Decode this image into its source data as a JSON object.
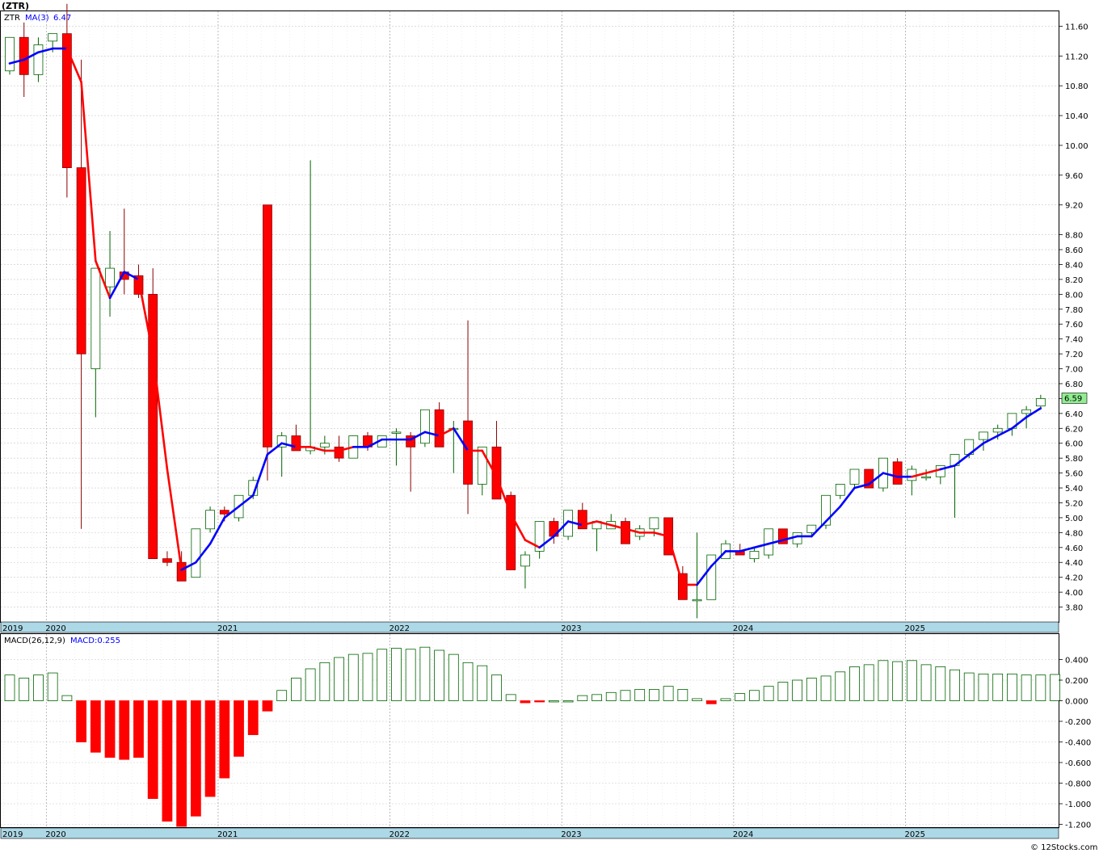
{
  "header": {
    "symbol_label": "(ZTR)",
    "legend_symbol": "ZTR",
    "legend_ma": "MA(3)",
    "legend_ma_value": "6.47",
    "last_price": "6.59"
  },
  "macd_header": {
    "label": "MACD(26,12,9)",
    "value_label": "MACD:0.255"
  },
  "footer": {
    "copyright": "© 12Stocks.com"
  },
  "colors": {
    "up": "#006400",
    "down": "#ff0000",
    "ma_up": "#0000ff",
    "ma_down": "#ff0000",
    "axis_band": "#add8e6",
    "last_price_bg": "#90ee90"
  },
  "chart_data": [
    {
      "type": "candlestick",
      "name": "price",
      "ylim": [
        3.6,
        11.8
      ],
      "ticks": [
        3.8,
        4.0,
        4.2,
        4.4,
        4.6,
        4.8,
        5.0,
        5.2,
        5.4,
        5.6,
        5.8,
        6.0,
        6.2,
        6.4,
        6.6,
        6.8,
        7.0,
        7.2,
        7.4,
        7.6,
        7.8,
        8.0,
        8.2,
        8.4,
        8.6,
        8.8,
        9.2,
        9.6,
        10.0,
        10.4,
        10.8,
        11.2,
        11.6
      ],
      "tick_labels": [
        "3.80",
        "4.00",
        "4.20",
        "4.40",
        "4.60",
        "4.80",
        "5.00",
        "5.20",
        "5.40",
        "5.60",
        "5.80",
        "6.00",
        "6.20",
        "6.40",
        "6.60",
        "6.80",
        "7.00",
        "7.20",
        "7.40",
        "7.60",
        "7.80",
        "8.00",
        "8.20",
        "8.40",
        "8.60",
        "8.80",
        "9.20",
        "9.60",
        "10.00",
        "10.40",
        "10.80",
        "11.20",
        "11.60"
      ],
      "x_axis_labels": [
        "2019",
        "2020",
        "2021",
        "2022",
        "2023",
        "2024",
        "2025"
      ],
      "year_start_index": [
        0,
        3,
        15,
        27,
        39,
        51,
        63
      ],
      "ohlc": [
        [
          11.0,
          11.45,
          10.95,
          11.45
        ],
        [
          11.45,
          11.65,
          10.65,
          10.95
        ],
        [
          10.95,
          11.45,
          10.85,
          11.35
        ],
        [
          11.4,
          11.5,
          11.25,
          11.5
        ],
        [
          11.5,
          11.9,
          9.3,
          9.7
        ],
        [
          9.7,
          11.15,
          4.85,
          7.2
        ],
        [
          7.0,
          8.35,
          6.35,
          8.35
        ],
        [
          8.1,
          8.85,
          7.7,
          8.35
        ],
        [
          8.3,
          9.15,
          8.0,
          8.2
        ],
        [
          8.25,
          8.4,
          7.95,
          8.0
        ],
        [
          8.0,
          8.35,
          4.45,
          4.45
        ],
        [
          4.45,
          4.55,
          4.35,
          4.4
        ],
        [
          4.4,
          4.55,
          4.15,
          4.15
        ],
        [
          4.2,
          4.85,
          4.2,
          4.85
        ],
        [
          4.85,
          5.15,
          4.8,
          5.1
        ],
        [
          5.1,
          5.15,
          4.95,
          5.05
        ],
        [
          5.0,
          5.3,
          4.95,
          5.3
        ],
        [
          5.3,
          5.55,
          5.25,
          5.5
        ],
        [
          9.2,
          9.2,
          5.5,
          5.95
        ],
        [
          5.95,
          6.15,
          5.55,
          6.1
        ],
        [
          6.1,
          6.25,
          5.9,
          5.9
        ],
        [
          5.9,
          9.8,
          5.85,
          5.95
        ],
        [
          5.95,
          6.1,
          5.85,
          6.0
        ],
        [
          5.95,
          6.1,
          5.75,
          5.8
        ],
        [
          5.8,
          6.1,
          5.8,
          6.1
        ],
        [
          6.1,
          6.15,
          5.9,
          5.95
        ],
        [
          5.95,
          6.1,
          5.95,
          6.1
        ],
        [
          6.15,
          6.2,
          5.7,
          6.15
        ],
        [
          6.1,
          6.15,
          5.35,
          5.95
        ],
        [
          6.0,
          6.45,
          5.95,
          6.45
        ],
        [
          6.45,
          6.55,
          5.95,
          5.95
        ],
        [
          6.2,
          6.3,
          5.6,
          6.2
        ],
        [
          6.3,
          7.65,
          5.05,
          5.45
        ],
        [
          5.45,
          5.95,
          5.3,
          5.95
        ],
        [
          5.95,
          6.3,
          5.25,
          5.25
        ],
        [
          5.3,
          5.35,
          4.3,
          4.3
        ],
        [
          4.35,
          4.55,
          4.05,
          4.5
        ],
        [
          4.55,
          4.95,
          4.45,
          4.95
        ],
        [
          4.95,
          5.0,
          4.65,
          4.75
        ],
        [
          4.75,
          5.1,
          4.7,
          5.1
        ],
        [
          5.1,
          5.2,
          4.85,
          4.85
        ],
        [
          4.85,
          4.95,
          4.55,
          4.95
        ],
        [
          4.85,
          5.05,
          4.85,
          4.95
        ],
        [
          4.95,
          5.0,
          4.65,
          4.65
        ],
        [
          4.75,
          4.9,
          4.7,
          4.85
        ],
        [
          4.85,
          5.0,
          4.75,
          5.0
        ],
        [
          5.0,
          5.0,
          4.5,
          4.5
        ],
        [
          4.25,
          4.35,
          3.9,
          3.9
        ],
        [
          3.9,
          4.8,
          3.65,
          3.9
        ],
        [
          3.9,
          4.5,
          3.9,
          4.5
        ],
        [
          4.45,
          4.7,
          4.45,
          4.65
        ],
        [
          4.55,
          4.65,
          4.5,
          4.5
        ],
        [
          4.45,
          4.6,
          4.4,
          4.55
        ],
        [
          4.5,
          4.85,
          4.45,
          4.85
        ],
        [
          4.85,
          4.85,
          4.65,
          4.65
        ],
        [
          4.65,
          4.8,
          4.6,
          4.8
        ],
        [
          4.8,
          4.9,
          4.75,
          4.9
        ],
        [
          4.9,
          5.3,
          4.85,
          5.3
        ],
        [
          5.3,
          5.45,
          5.25,
          5.45
        ],
        [
          5.45,
          5.65,
          5.4,
          5.65
        ],
        [
          5.65,
          5.65,
          5.4,
          5.4
        ],
        [
          5.4,
          5.8,
          5.35,
          5.8
        ],
        [
          5.75,
          5.8,
          5.45,
          5.45
        ],
        [
          5.5,
          5.7,
          5.3,
          5.65
        ],
        [
          5.55,
          5.65,
          5.5,
          5.55
        ],
        [
          5.55,
          5.7,
          5.45,
          5.7
        ],
        [
          5.7,
          5.85,
          5.0,
          5.85
        ],
        [
          5.85,
          6.05,
          5.8,
          6.05
        ],
        [
          6.05,
          6.15,
          5.9,
          6.15
        ],
        [
          6.15,
          6.25,
          6.05,
          6.2
        ],
        [
          6.2,
          6.4,
          6.1,
          6.4
        ],
        [
          6.4,
          6.5,
          6.2,
          6.45
        ],
        [
          6.5,
          6.65,
          6.45,
          6.6
        ]
      ],
      "ma": [
        11.1,
        11.15,
        11.25,
        11.3,
        11.3,
        10.85,
        8.45,
        7.95,
        8.3,
        8.2,
        7.2,
        5.65,
        4.3,
        4.4,
        4.65,
        5.0,
        5.15,
        5.3,
        5.85,
        6.0,
        5.95,
        5.95,
        5.9,
        5.9,
        5.95,
        5.95,
        6.05,
        6.05,
        6.05,
        6.15,
        6.1,
        6.2,
        5.9,
        5.9,
        5.55,
        5.05,
        4.7,
        4.6,
        4.75,
        4.95,
        4.9,
        4.95,
        4.9,
        4.85,
        4.8,
        4.8,
        4.75,
        4.1,
        4.1,
        4.35,
        4.55,
        4.55,
        4.6,
        4.65,
        4.7,
        4.75,
        4.75,
        4.95,
        5.15,
        5.4,
        5.45,
        5.6,
        5.55,
        5.55,
        5.6,
        5.65,
        5.7,
        5.85,
        6.0,
        6.1,
        6.2,
        6.35,
        6.47
      ],
      "ma_dir": [
        "up",
        "up",
        "up",
        "up",
        "down",
        "down",
        "down",
        "up",
        "up",
        "down",
        "down",
        "down",
        "up",
        "up",
        "up",
        "up",
        "up",
        "up",
        "up",
        "up",
        "down",
        "down",
        "down",
        "down",
        "up",
        "up",
        "up",
        "up",
        "up",
        "up",
        "down",
        "up",
        "down",
        "down",
        "down",
        "down",
        "down",
        "up",
        "up",
        "up",
        "down",
        "down",
        "down",
        "down",
        "down",
        "down",
        "down",
        "down",
        "up",
        "up",
        "up",
        "up",
        "up",
        "up",
        "up",
        "up",
        "up",
        "up",
        "up",
        "up",
        "up",
        "up",
        "up",
        "down",
        "down",
        "up",
        "up",
        "up",
        "up",
        "up",
        "up",
        "up",
        "up"
      ]
    },
    {
      "type": "bar",
      "name": "MACD",
      "ylim": [
        -1.28,
        0.55
      ],
      "ticks": [
        -1.2,
        -1.0,
        -0.8,
        -0.6,
        -0.4,
        -0.2,
        0.0,
        0.2,
        0.4
      ],
      "tick_labels": [
        "-1.200",
        "-1.000",
        "-0.800",
        "-0.600",
        "-0.400",
        "-0.200",
        "0.000",
        "0.200",
        "0.400"
      ],
      "values": [
        0.25,
        0.22,
        0.25,
        0.27,
        0.05,
        -0.4,
        -0.5,
        -0.55,
        -0.57,
        -0.55,
        -0.95,
        -1.17,
        -1.22,
        -1.12,
        -0.93,
        -0.75,
        -0.54,
        -0.33,
        -0.1,
        0.1,
        0.22,
        0.31,
        0.37,
        0.42,
        0.45,
        0.46,
        0.5,
        0.51,
        0.5,
        0.52,
        0.49,
        0.45,
        0.37,
        0.34,
        0.25,
        0.06,
        -0.02,
        -0.01,
        0.0,
        0.0,
        0.05,
        0.06,
        0.08,
        0.1,
        0.11,
        0.11,
        0.14,
        0.11,
        0.02,
        -0.03,
        0.02,
        0.07,
        0.1,
        0.14,
        0.18,
        0.2,
        0.22,
        0.24,
        0.28,
        0.33,
        0.35,
        0.39,
        0.38,
        0.39,
        0.35,
        0.33,
        0.3,
        0.27,
        0.26,
        0.26,
        0.26,
        0.25,
        0.25,
        0.255
      ]
    }
  ]
}
